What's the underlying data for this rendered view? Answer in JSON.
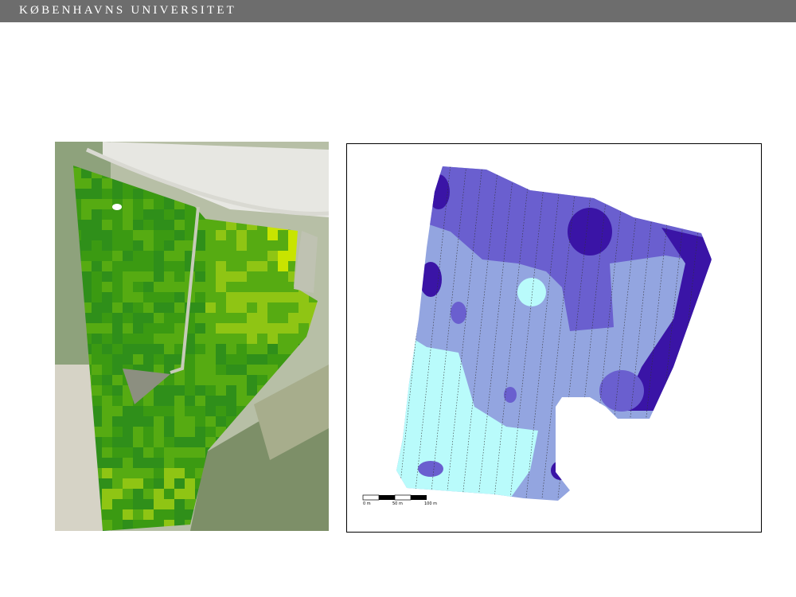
{
  "header": {
    "title": "KØBENHAVNS UNIVERSITET",
    "bar_color": "#6d6d6d"
  },
  "left_map": {
    "name": "satellite field vegetation index overlay",
    "colors": [
      "#2f8f1a",
      "#3b9a12",
      "#56ab12",
      "#8fc514",
      "#c8e400"
    ]
  },
  "right_map": {
    "name": "field zone map",
    "zone_colors": [
      "#b9fbfb",
      "#93a5e0",
      "#6a5fcf",
      "#3a14a6"
    ],
    "scale_bar": {
      "labels": [
        "0 m",
        "50 m",
        "100 m"
      ]
    }
  }
}
